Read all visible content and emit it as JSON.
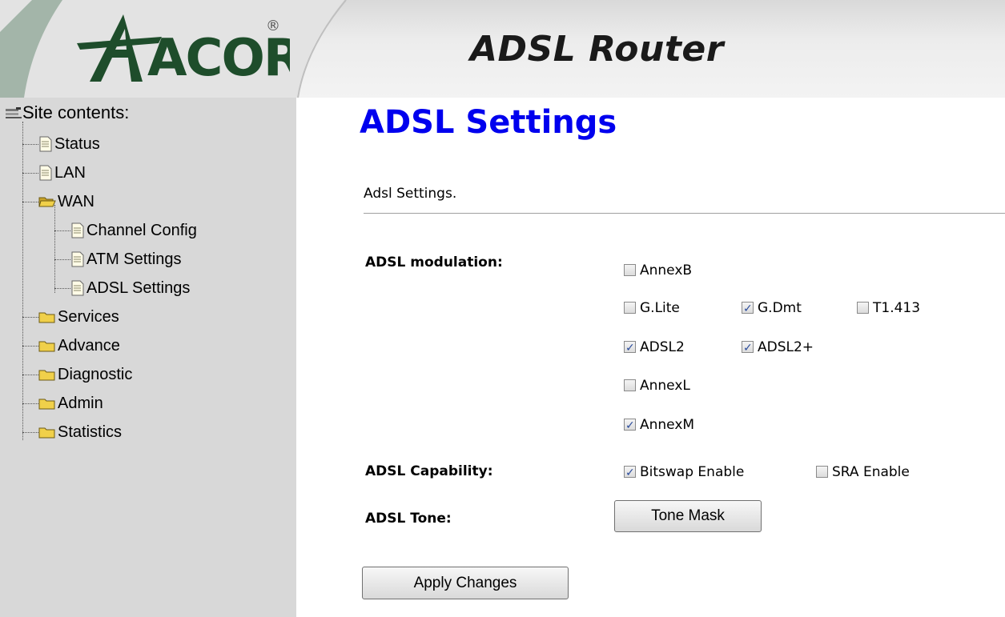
{
  "header": {
    "logo_text": "ACORP",
    "logo_mark": "®",
    "title": "ADSL Router"
  },
  "sidebar": {
    "root_label": "Site contents:",
    "items": [
      {
        "label": "Status",
        "icon": "page-icon"
      },
      {
        "label": "LAN",
        "icon": "page-icon"
      },
      {
        "label": "WAN",
        "icon": "open-folder-icon"
      },
      {
        "label": "Channel Config",
        "icon": "page-icon"
      },
      {
        "label": "ATM Settings",
        "icon": "page-icon"
      },
      {
        "label": "ADSL Settings",
        "icon": "page-icon"
      },
      {
        "label": "Services",
        "icon": "folder-icon"
      },
      {
        "label": "Advance",
        "icon": "folder-icon"
      },
      {
        "label": "Diagnostic",
        "icon": "folder-icon"
      },
      {
        "label": "Admin",
        "icon": "folder-icon"
      },
      {
        "label": "Statistics",
        "icon": "folder-icon"
      }
    ]
  },
  "main": {
    "title": "ADSL Settings",
    "description": "Adsl Settings.",
    "modulation_label": "ADSL modulation:",
    "modulation": {
      "annexb": {
        "label": "AnnexB",
        "checked": false
      },
      "glite": {
        "label": "G.Lite",
        "checked": false
      },
      "gdmt": {
        "label": "G.Dmt",
        "checked": true
      },
      "t1413": {
        "label": "T1.413",
        "checked": false
      },
      "adsl2": {
        "label": "ADSL2",
        "checked": true
      },
      "adsl2plus": {
        "label": "ADSL2+",
        "checked": true
      },
      "annexl": {
        "label": "AnnexL",
        "checked": false
      },
      "annexm": {
        "label": "AnnexM",
        "checked": true
      }
    },
    "capability_label": "ADSL Capability:",
    "capability": {
      "bitswap": {
        "label": "Bitswap Enable",
        "checked": true
      },
      "sra": {
        "label": "SRA Enable",
        "checked": false
      }
    },
    "tone_label": "ADSL Tone:",
    "tone_button": "Tone Mask",
    "apply_button": "Apply Changes"
  },
  "colors": {
    "title_blue": "#0000ee",
    "sidebar_bg": "#d8d8d8",
    "check_blue": "#2a4b9b"
  }
}
